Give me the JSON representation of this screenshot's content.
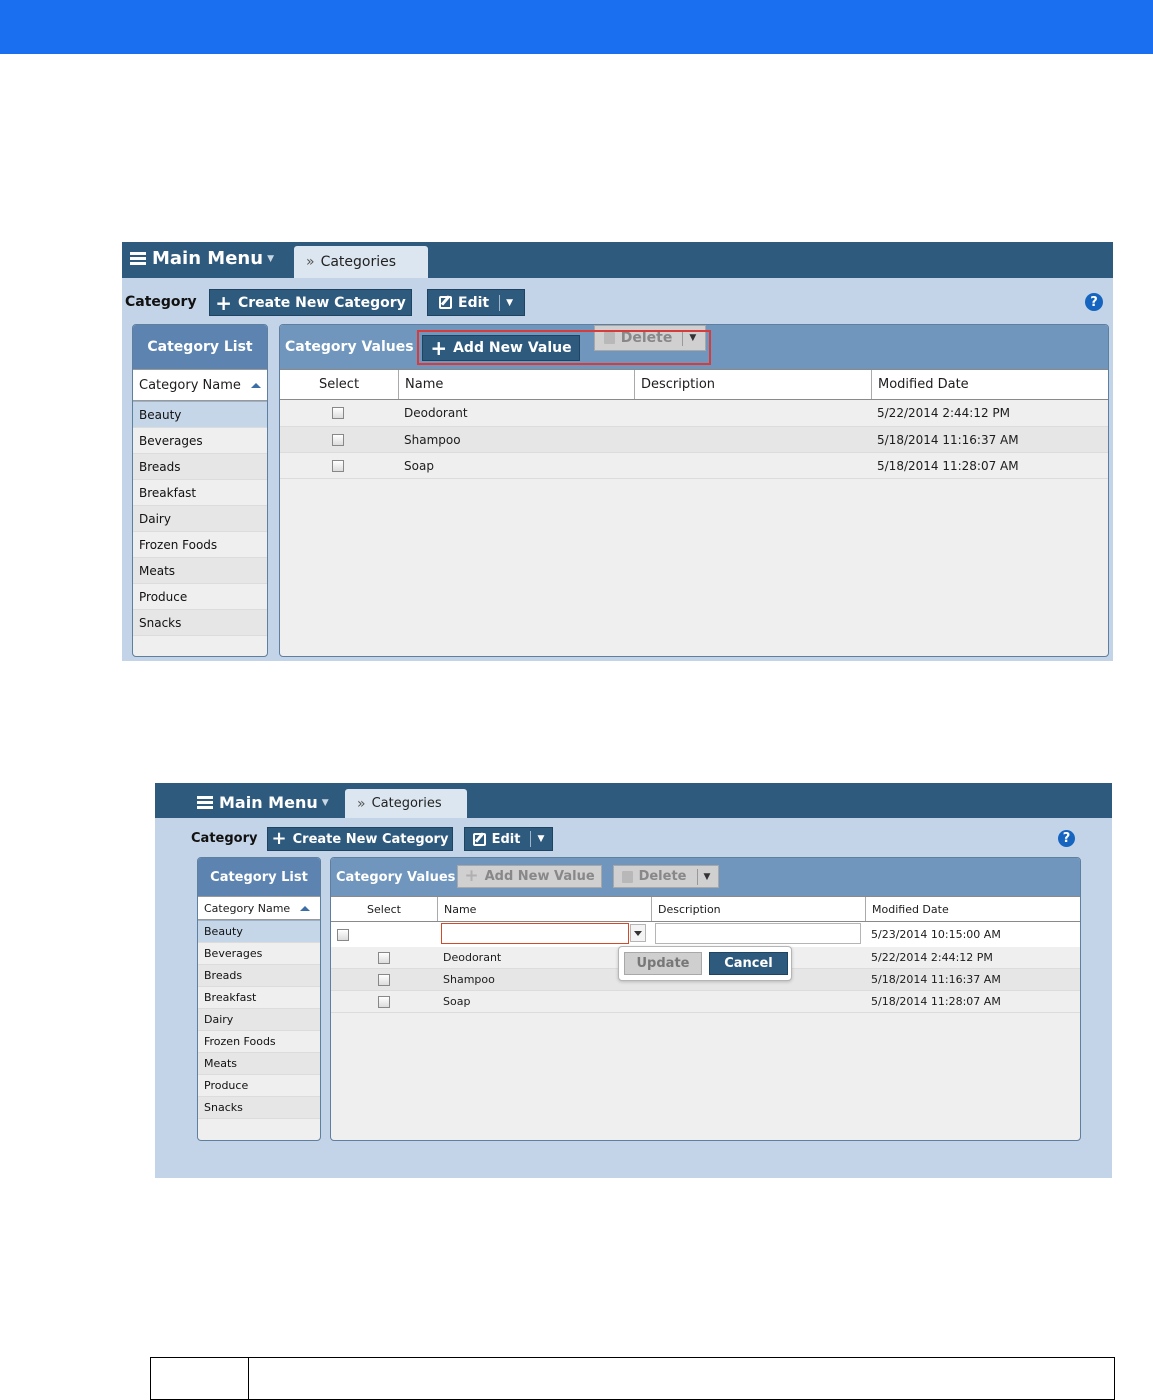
{
  "colors": {
    "top_bar": "#1a6ff0",
    "header": "#2e5a7d",
    "accent_blue": "#5d84b0",
    "highlight_border": "#d83b3b"
  },
  "screens": [
    {
      "main_menu": "Main Menu",
      "tab": "Categories",
      "toolbar": {
        "label": "Category",
        "create": "Create New Category",
        "edit": "Edit"
      },
      "category_list": {
        "title": "Category List",
        "column": "Category Name",
        "items": [
          "Beauty",
          "Beverages",
          "Breads",
          "Breakfast",
          "Dairy",
          "Frozen Foods",
          "Meats",
          "Produce",
          "Snacks"
        ],
        "selected": "Beauty"
      },
      "values": {
        "title": "Category Values",
        "add_button": "Add New Value",
        "delete_button": "Delete",
        "columns": [
          "Select",
          "Name",
          "Description",
          "Modified Date"
        ],
        "rows": [
          {
            "name": "Deodorant",
            "description": "",
            "modified": "5/22/2014 2:44:12 PM"
          },
          {
            "name": "Shampoo",
            "description": "",
            "modified": "5/18/2014 11:16:37 AM"
          },
          {
            "name": "Soap",
            "description": "",
            "modified": "5/18/2014 11:28:07 AM"
          }
        ]
      }
    },
    {
      "main_menu": "Main Menu",
      "tab": "Categories",
      "toolbar": {
        "label": "Category",
        "create": "Create New Category",
        "edit": "Edit"
      },
      "category_list": {
        "title": "Category List",
        "column": "Category Name",
        "items": [
          "Beauty",
          "Beverages",
          "Breads",
          "Breakfast",
          "Dairy",
          "Frozen Foods",
          "Meats",
          "Produce",
          "Snacks"
        ],
        "selected": "Beauty"
      },
      "values": {
        "title": "Category Values",
        "add_button": "Add New Value",
        "delete_button": "Delete",
        "columns": [
          "Select",
          "Name",
          "Description",
          "Modified Date"
        ],
        "edit_row": {
          "name_value": "",
          "description_value": "",
          "modified": "5/23/2014 10:15:00 AM"
        },
        "update_button": "Update",
        "cancel_button": "Cancel",
        "rows": [
          {
            "name": "Deodorant",
            "description": "",
            "modified": "5/22/2014 2:44:12 PM"
          },
          {
            "name": "Shampoo",
            "description": "",
            "modified": "5/18/2014 11:16:37 AM"
          },
          {
            "name": "Soap",
            "description": "",
            "modified": "5/18/2014 11:28:07 AM"
          }
        ]
      }
    }
  ]
}
